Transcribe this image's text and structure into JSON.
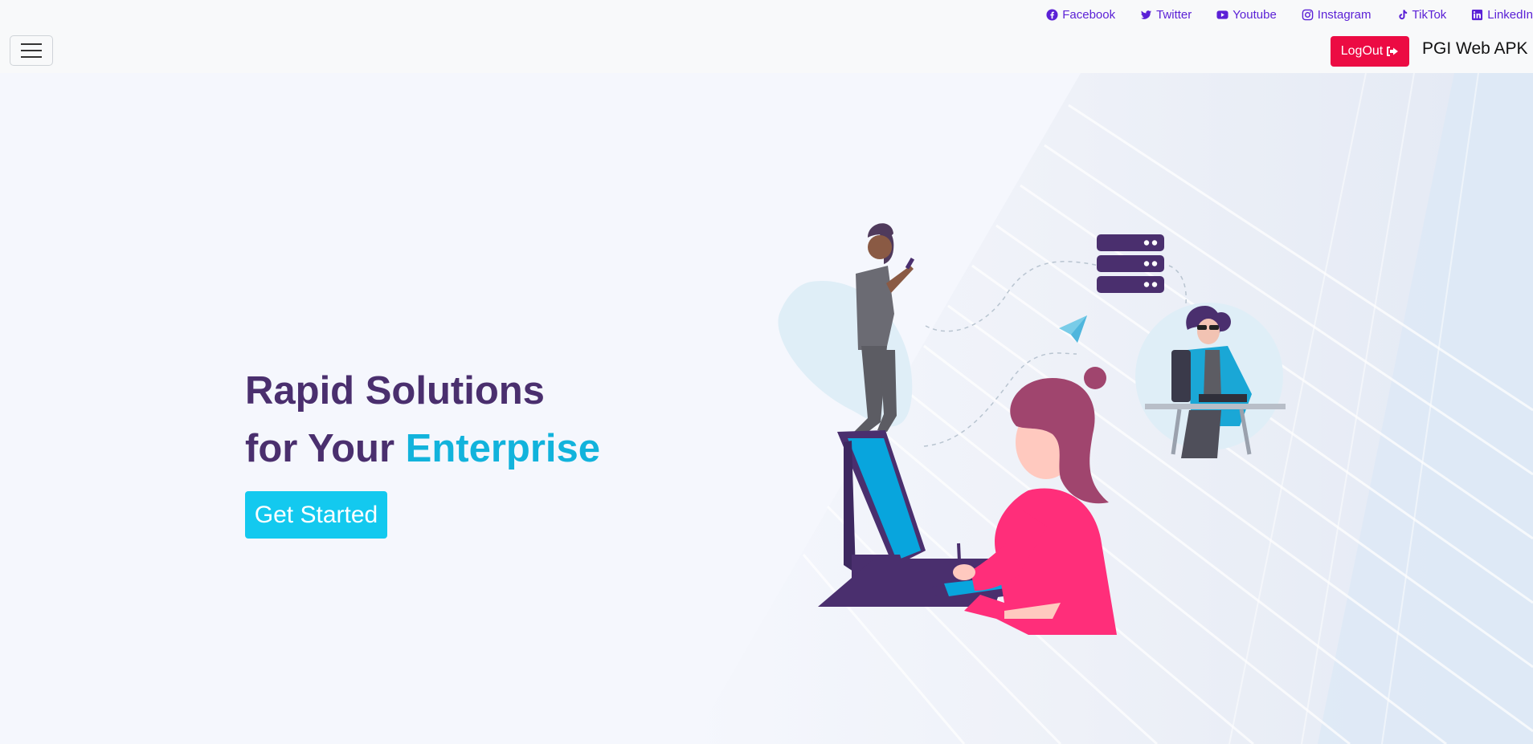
{
  "social": [
    {
      "label": "Facebook",
      "icon": "facebook-icon"
    },
    {
      "label": "Twitter",
      "icon": "twitter-icon"
    },
    {
      "label": "Youtube",
      "icon": "youtube-icon"
    },
    {
      "label": "Instagram",
      "icon": "instagram-icon"
    },
    {
      "label": "TikTok",
      "icon": "tiktok-icon"
    },
    {
      "label": "LinkedIn",
      "icon": "linkedin-icon"
    }
  ],
  "header": {
    "logout_label": "LogOut",
    "brand": "PGI Web APK"
  },
  "hero": {
    "line1": "Rapid Solutions",
    "line2_prefix": "for Your ",
    "line2_accent": "Enterprise",
    "cta_label": "Get Started"
  },
  "colors": {
    "link": "#5b21d6",
    "logout": "#ec0b43",
    "title": "#4a2f6e",
    "accent": "#12b3dc",
    "cta": "#13c9ef"
  }
}
